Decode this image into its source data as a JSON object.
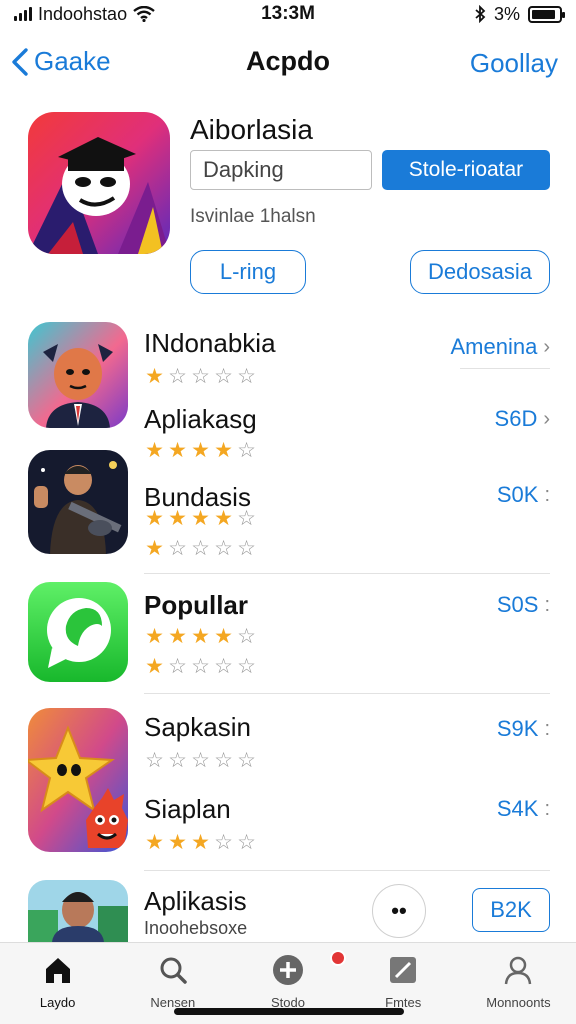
{
  "status": {
    "carrier": "Indoohstao",
    "time": "13:3M",
    "battery_text": "3%",
    "battery_level": 0.9
  },
  "nav": {
    "back_label": "Gaake",
    "title": "Acpdo",
    "right_label": "Goollay"
  },
  "featured": {
    "name": "Aiborlasia",
    "input_value": "Dapking",
    "primary_button": "Stole-rioatar",
    "subtitle": "Isvinlae 1halsn",
    "left_button": "L-ring",
    "right_button": "Dedosasia"
  },
  "apps": [
    {
      "title_1": "INdonabkia",
      "rating_1": 1,
      "title_2": "Apliakasg",
      "rating_2": 4,
      "action_1": "Amenina",
      "action_2": "S6D"
    },
    {
      "title": "Bundasis",
      "rating_1": 4,
      "rating_2": 1,
      "action": "S0K"
    },
    {
      "title": "Popullar",
      "rating_1": 4,
      "rating_2": 1,
      "action": "S0S"
    },
    {
      "title_1": "Sapkasin",
      "rating_1": 0,
      "title_2": "Siaplan",
      "rating_2": 3,
      "action_1": "S9K",
      "action_2": "S4K"
    },
    {
      "title": "Aplikasis",
      "subtitle": "Inoohebsoxe",
      "more_label": "••",
      "button": "B2K"
    }
  ],
  "tabs": [
    {
      "label": "Laydo",
      "icon": "home-icon"
    },
    {
      "label": "Nensen",
      "icon": "search-icon"
    },
    {
      "label": "Stodo",
      "icon": "plus-icon"
    },
    {
      "label": "Fmtes",
      "icon": "edit-icon"
    },
    {
      "label": "Monnoonts",
      "icon": "person-icon"
    }
  ],
  "colors": {
    "accent": "#1a7bd8",
    "star": "#f4a722",
    "badge": "#e23636"
  }
}
